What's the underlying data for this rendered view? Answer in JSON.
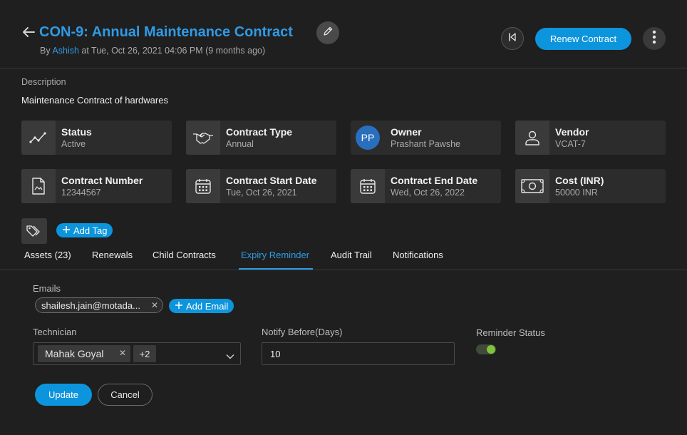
{
  "header": {
    "title": "CON-9: Annual Maintenance Contract",
    "by_label": "By ",
    "author": "Ashish",
    "at_label": " at Tue, Oct 26, 2021 04:06 PM (9 months ago)",
    "renew_label": "Renew Contract"
  },
  "description": {
    "label": "Description",
    "text": "Maintenance Contract of hardwares"
  },
  "cards": [
    {
      "label": "Status",
      "value": "Active",
      "icon": "trend-icon"
    },
    {
      "label": "Contract Type",
      "value": "Annual",
      "icon": "handshake-icon"
    },
    {
      "label": "Owner",
      "value": "Prashant Pawshe",
      "icon": "avatar",
      "initials": "PP"
    },
    {
      "label": "Vendor",
      "value": "VCAT-7",
      "icon": "user-icon"
    },
    {
      "label": "Contract Number",
      "value": "12344567",
      "icon": "document-icon"
    },
    {
      "label": "Contract Start Date",
      "value": "Tue, Oct 26, 2021",
      "icon": "calendar-icon"
    },
    {
      "label": "Contract End Date",
      "value": "Wed, Oct 26, 2022",
      "icon": "calendar-icon"
    },
    {
      "label": "Cost (INR)",
      "value": "50000 INR",
      "icon": "cash-icon"
    }
  ],
  "tags": {
    "add_label": "Add Tag"
  },
  "tabs": [
    {
      "label": "Assets (23)"
    },
    {
      "label": "Renewals"
    },
    {
      "label": "Child Contracts"
    },
    {
      "label": "Expiry Reminder",
      "active": true
    },
    {
      "label": "Audit Trail"
    },
    {
      "label": "Notifications"
    }
  ],
  "form": {
    "emails_label": "Emails",
    "email_chip": "shailesh.jain@motada...",
    "add_email_label": "Add Email",
    "technician_label": "Technician",
    "technician_chip": "Mahak Goyal",
    "technician_more": "+2",
    "notify_label": "Notify Before(Days)",
    "notify_value": "10",
    "reminder_label": "Reminder Status",
    "reminder_on": true,
    "update_label": "Update",
    "cancel_label": "Cancel"
  },
  "colors": {
    "accent": "#0c95dd",
    "link": "#2f9be6",
    "toggle_on": "#7fc43a",
    "background": "#1f1f1f"
  }
}
